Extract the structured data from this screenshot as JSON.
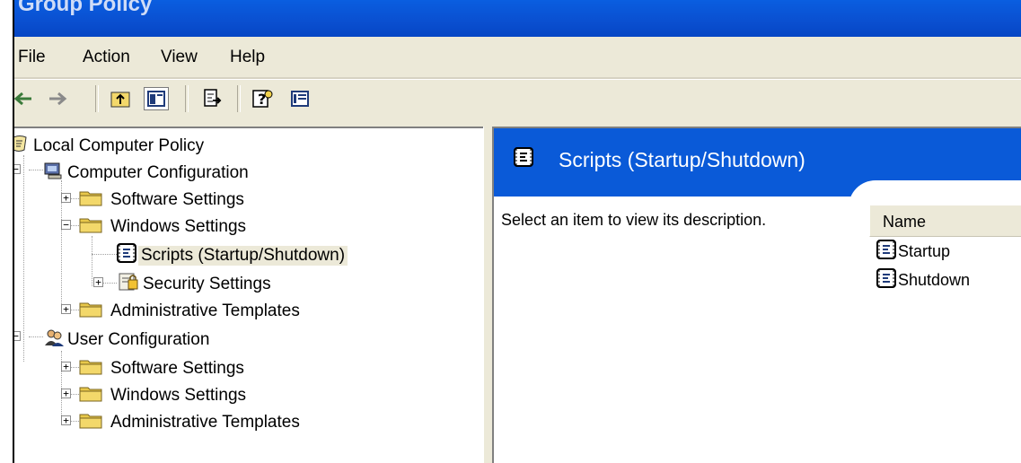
{
  "window": {
    "title": "Group Policy"
  },
  "menu": {
    "file": "File",
    "action": "Action",
    "view": "View",
    "help": "Help"
  },
  "toolbar": {
    "buttons": [
      "back-arrow-icon",
      "forward-arrow-icon",
      "up-folder-icon",
      "show-hide-tree-icon",
      "export-list-icon",
      "help-icon",
      "action-pane-icon"
    ]
  },
  "tree": {
    "root": "Local Computer Policy",
    "computer_config": "Computer Configuration",
    "cc_software": "Software Settings",
    "cc_windows": "Windows Settings",
    "cc_scripts": "Scripts (Startup/Shutdown)",
    "cc_security": "Security Settings",
    "cc_admin": "Administrative Templates",
    "user_config": "User Configuration",
    "uc_software": "Software Settings",
    "uc_windows": "Windows Settings",
    "uc_admin": "Administrative Templates"
  },
  "details": {
    "title": "Scripts (Startup/Shutdown)",
    "description": "Select an item to view its description.",
    "column_name": "Name",
    "items": [
      "Startup",
      "Shutdown"
    ]
  },
  "colors": {
    "banner": "#0a5ad8",
    "titlebar": "#0a4fd0",
    "chrome": "#ece9d8",
    "folder": "#e8c84a"
  }
}
